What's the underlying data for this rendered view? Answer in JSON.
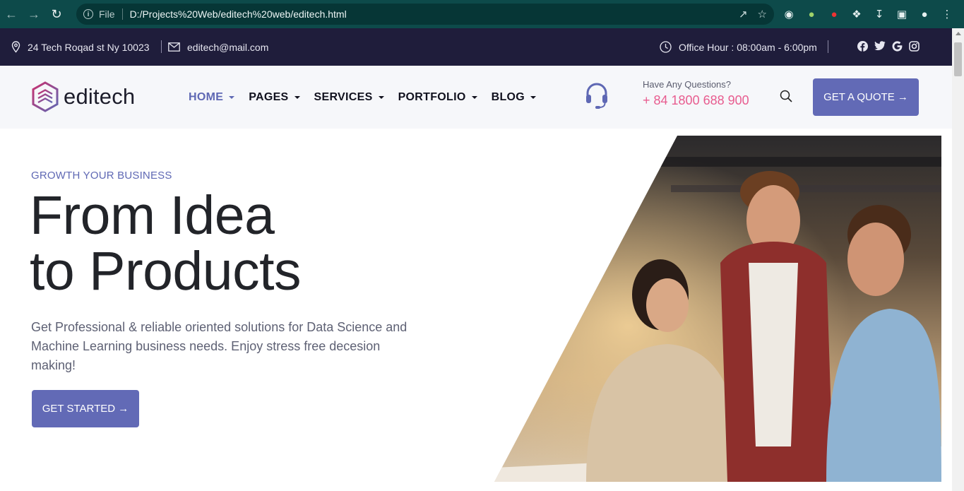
{
  "browser": {
    "scheme_label": "File",
    "url": "D:/Projects%20Web/editech%20web/editech.html"
  },
  "topbar": {
    "address": "24 Tech Roqad st Ny 10023",
    "email": "editech@mail.com",
    "office_hours": "Office Hour : 08:00am - 6:00pm",
    "social": [
      "facebook-icon",
      "twitter-icon",
      "google-icon",
      "instagram-icon"
    ]
  },
  "header": {
    "logo_text": "editech",
    "menu": [
      {
        "label": "HOME",
        "active": true
      },
      {
        "label": "PAGES",
        "active": false
      },
      {
        "label": "SERVICES",
        "active": false
      },
      {
        "label": "PORTFOLIO",
        "active": false
      },
      {
        "label": "BLOG",
        "active": false
      }
    ],
    "questions_label": "Have Any Questions?",
    "phone": "+ 84 1800 688 900",
    "quote_button": "GET A QUOTE →"
  },
  "hero": {
    "eyebrow": "GROWTH YOUR BUSINESS",
    "headline_line1": "From Idea",
    "headline_line2": "to Products",
    "lead": "Get Professional & reliable oriented solutions for Data Science and Machine Learning business needs. Enjoy stress free decesion making!",
    "cta_button": "GET STARTED →"
  },
  "colors": {
    "accent": "#626ab6",
    "phone_pink": "#e85c8f",
    "topbar_bg": "#1f1d3b"
  }
}
